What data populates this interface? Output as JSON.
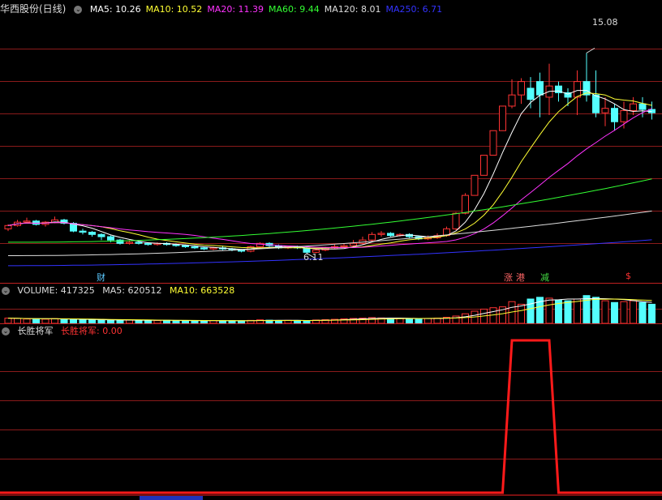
{
  "main": {
    "title": "华西股份(日线)",
    "ma_labels": [
      {
        "text": "MA5: 10.26",
        "color": "#ffffff"
      },
      {
        "text": "MA10: 10.52",
        "color": "#ffff33"
      },
      {
        "text": "MA20: 11.39",
        "color": "#ff33ff"
      },
      {
        "text": "MA60: 9.44",
        "color": "#33ff33"
      },
      {
        "text": "MA120: 8.01",
        "color": "#dddddd"
      },
      {
        "text": "MA250: 6.71",
        "color": "#3333ff"
      }
    ],
    "high_label": "15.08",
    "low_label": "6.11",
    "event_tags": [
      {
        "text": "财",
        "color": "#5bc8ff"
      },
      {
        "text": "涨",
        "color": "#ff6666"
      },
      {
        "text": "港",
        "color": "#ff6666"
      },
      {
        "text": "减",
        "color": "#44dd44"
      },
      {
        "text": "$",
        "color": "#ff3333"
      }
    ],
    "price_range": [
      5.4,
      16.8
    ],
    "candles": [
      [
        7.2,
        7.35,
        7.4,
        7.1
      ],
      [
        7.35,
        7.5,
        7.6,
        7.3
      ],
      [
        7.5,
        7.55,
        7.7,
        7.45
      ],
      [
        7.55,
        7.4,
        7.6,
        7.35
      ],
      [
        7.4,
        7.5,
        7.55,
        7.3
      ],
      [
        7.5,
        7.6,
        7.75,
        7.45
      ],
      [
        7.6,
        7.45,
        7.65,
        7.4
      ],
      [
        7.45,
        7.1,
        7.5,
        7.05
      ],
      [
        7.1,
        7.05,
        7.2,
        6.95
      ],
      [
        7.05,
        6.95,
        7.1,
        6.85
      ],
      [
        6.95,
        6.85,
        7.0,
        6.7
      ],
      [
        6.85,
        6.7,
        6.9,
        6.6
      ],
      [
        6.7,
        6.55,
        6.75,
        6.5
      ],
      [
        6.55,
        6.6,
        6.7,
        6.5
      ],
      [
        6.6,
        6.55,
        6.65,
        6.5
      ],
      [
        6.55,
        6.5,
        6.6,
        6.45
      ],
      [
        6.5,
        6.55,
        6.6,
        6.45
      ],
      [
        6.55,
        6.5,
        6.6,
        6.45
      ],
      [
        6.5,
        6.45,
        6.55,
        6.4
      ],
      [
        6.45,
        6.4,
        6.5,
        6.35
      ],
      [
        6.4,
        6.35,
        6.45,
        6.3
      ],
      [
        6.35,
        6.3,
        6.4,
        6.25
      ],
      [
        6.3,
        6.35,
        6.4,
        6.25
      ],
      [
        6.35,
        6.3,
        6.45,
        6.25
      ],
      [
        6.3,
        6.25,
        6.35,
        6.2
      ],
      [
        6.25,
        6.2,
        6.3,
        6.15
      ],
      [
        6.2,
        6.4,
        6.45,
        6.15
      ],
      [
        6.4,
        6.55,
        6.6,
        6.35
      ],
      [
        6.55,
        6.45,
        6.6,
        6.4
      ],
      [
        6.45,
        6.35,
        6.5,
        6.3
      ],
      [
        6.35,
        6.4,
        6.45,
        6.3
      ],
      [
        6.4,
        6.35,
        6.45,
        6.3
      ],
      [
        6.35,
        6.15,
        6.4,
        6.11
      ],
      [
        6.15,
        6.25,
        6.3,
        6.11
      ],
      [
        6.25,
        6.35,
        6.4,
        6.2
      ],
      [
        6.35,
        6.4,
        6.5,
        6.3
      ],
      [
        6.4,
        6.45,
        6.55,
        6.35
      ],
      [
        6.45,
        6.55,
        6.7,
        6.4
      ],
      [
        6.55,
        6.7,
        6.85,
        6.5
      ],
      [
        6.7,
        6.95,
        7.05,
        6.65
      ],
      [
        6.95,
        7.0,
        7.1,
        6.85
      ],
      [
        7.0,
        6.9,
        7.05,
        6.85
      ],
      [
        6.9,
        6.95,
        7.0,
        6.85
      ],
      [
        6.95,
        6.85,
        7.0,
        6.8
      ],
      [
        6.85,
        6.75,
        6.9,
        6.7
      ],
      [
        6.75,
        6.8,
        6.9,
        6.7
      ],
      [
        6.8,
        6.9,
        7.0,
        6.75
      ],
      [
        6.9,
        7.2,
        7.3,
        6.85
      ],
      [
        7.2,
        7.9,
        7.95,
        7.15
      ],
      [
        7.9,
        8.7,
        8.8,
        7.85
      ],
      [
        8.7,
        9.6,
        9.6,
        8.7
      ],
      [
        9.6,
        10.5,
        10.5,
        9.6
      ],
      [
        10.5,
        11.6,
        11.6,
        10.5
      ],
      [
        11.6,
        12.7,
        12.7,
        11.6
      ],
      [
        12.7,
        13.2,
        13.9,
        12.6
      ],
      [
        13.2,
        13.8,
        13.95,
        12.8
      ],
      [
        13.5,
        13.0,
        14.0,
        12.6
      ],
      [
        13.8,
        13.2,
        14.2,
        12.2
      ],
      [
        13.1,
        13.6,
        14.6,
        12.3
      ],
      [
        13.6,
        13.3,
        13.8,
        12.9
      ],
      [
        13.3,
        13.1,
        13.5,
        12.7
      ],
      [
        13.1,
        13.8,
        14.3,
        12.3
      ],
      [
        13.8,
        13.2,
        15.08,
        12.9
      ],
      [
        13.2,
        12.4,
        14.3,
        12.2
      ],
      [
        12.4,
        12.6,
        13.1,
        11.8
      ],
      [
        12.6,
        12.0,
        12.8,
        11.6
      ],
      [
        12.0,
        12.5,
        12.9,
        11.7
      ],
      [
        12.5,
        12.8,
        13.1,
        12.3
      ],
      [
        12.8,
        12.55,
        13.1,
        12.2
      ],
      [
        12.55,
        12.4,
        12.9,
        12.1
      ]
    ]
  },
  "volume": {
    "label": "VOLUME: 417325",
    "ma5_label": "MA5: 620512",
    "ma10_label": "MA10: 663528",
    "values": [
      300,
      280,
      250,
      260,
      240,
      270,
      230,
      220,
      210,
      200,
      190,
      180,
      170,
      190,
      180,
      170,
      160,
      170,
      160,
      150,
      150,
      145,
      160,
      155,
      150,
      145,
      170,
      200,
      180,
      160,
      170,
      165,
      150,
      190,
      210,
      230,
      260,
      280,
      300,
      330,
      310,
      290,
      280,
      270,
      260,
      280,
      300,
      350,
      420,
      550,
      700,
      820,
      900,
      950,
      1250,
      1100,
      1400,
      1500,
      1450,
      1350,
      1300,
      1400,
      1600,
      1500,
      1300,
      1200,
      1250,
      1300,
      1200,
      1100
    ]
  },
  "indicator": {
    "title": "长胜将军",
    "value_label": "长胜将军: 0.00",
    "signal_values": [
      0,
      0,
      0,
      0,
      0,
      0,
      0,
      0,
      0,
      0,
      0,
      0,
      0,
      0,
      0,
      0,
      0,
      0,
      0,
      0,
      0,
      0,
      0,
      0,
      0,
      0,
      0,
      0,
      0,
      0,
      0,
      0,
      0,
      0,
      0,
      0,
      0,
      0,
      0,
      0,
      0,
      0,
      0,
      0,
      0,
      0,
      0,
      0,
      0,
      0,
      0,
      0,
      0,
      0,
      1,
      1,
      1,
      1,
      1,
      0,
      0,
      0,
      0,
      0,
      0,
      0,
      0,
      0,
      0,
      0
    ]
  },
  "colors": {
    "up": "#ff3333",
    "down": "#54ffff",
    "grid": "#8a1b1b",
    "signal": "#ff1a1a",
    "signal_label": "#ff3333"
  }
}
